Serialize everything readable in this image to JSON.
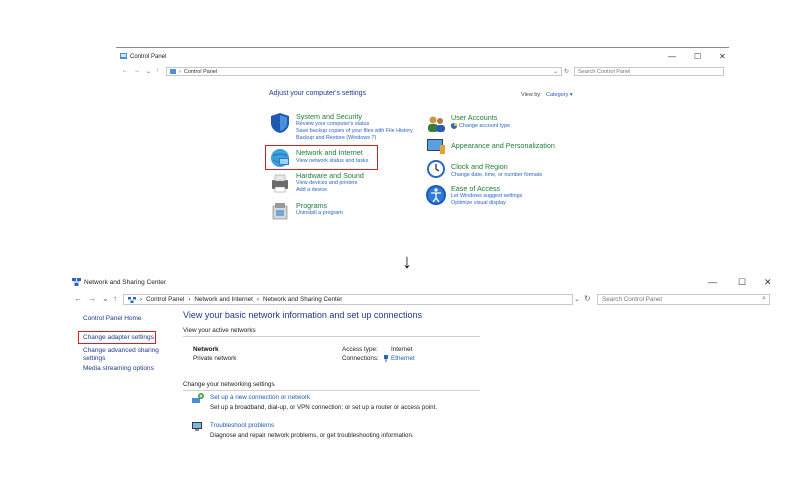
{
  "control_panel": {
    "title": "Control Panel",
    "window_controls": [
      "—",
      "☐",
      "✕"
    ],
    "address": "Control Panel",
    "search_placeholder": "Search Control Panel",
    "heading": "Adjust your computer's settings",
    "view_by_label": "View by:",
    "view_by_value": "Category",
    "categories": [
      {
        "title": "System and Security",
        "links": [
          "Review your computer's status",
          "Save backup copies of your files with File History",
          "Backup and Restore (Windows 7)"
        ]
      },
      {
        "title": "Network and Internet",
        "links": [
          "View network status and tasks"
        ]
      },
      {
        "title": "Hardware and Sound",
        "links": [
          "View devices and printers",
          "Add a device"
        ]
      },
      {
        "title": "Programs",
        "links": [
          "Uninstall a program"
        ]
      },
      {
        "title": "User Accounts",
        "links": [
          "Change account type"
        ]
      },
      {
        "title": "Appearance and Personalization",
        "links": []
      },
      {
        "title": "Clock and Region",
        "links": [
          "Change date, time, or number formats"
        ]
      },
      {
        "title": "Ease of Access",
        "links": [
          "Let Windows suggest settings",
          "Optimize visual display"
        ]
      }
    ]
  },
  "arrow": "↓",
  "network_center": {
    "title": "Network and Sharing Center",
    "window_controls": [
      "—",
      "☐",
      "✕"
    ],
    "breadcrumb": [
      "Control Panel",
      "Network and Internet",
      "Network and Sharing Center"
    ],
    "search_placeholder": "Search Control Panel",
    "sidebar": [
      "Control Panel Home",
      "Change adapter settings",
      "Change advanced sharing settings",
      "Media streaming options"
    ],
    "heading": "View your basic network information and set up connections",
    "active_networks_label": "View your active networks",
    "network_name": "Network",
    "network_type": "Private network",
    "access_type_label": "Access type:",
    "access_type_value": "Internet",
    "connections_label": "Connections:",
    "connections_value": "Ethernet",
    "change_settings_label": "Change your networking settings",
    "setup_link": "Set up a new connection or network",
    "setup_desc": "Set up a broadband, dial-up, or VPN connection; or set up a router or access point.",
    "troubleshoot_link": "Troubleshoot problems",
    "troubleshoot_desc": "Diagnose and repair network problems, or get troubleshooting information."
  }
}
